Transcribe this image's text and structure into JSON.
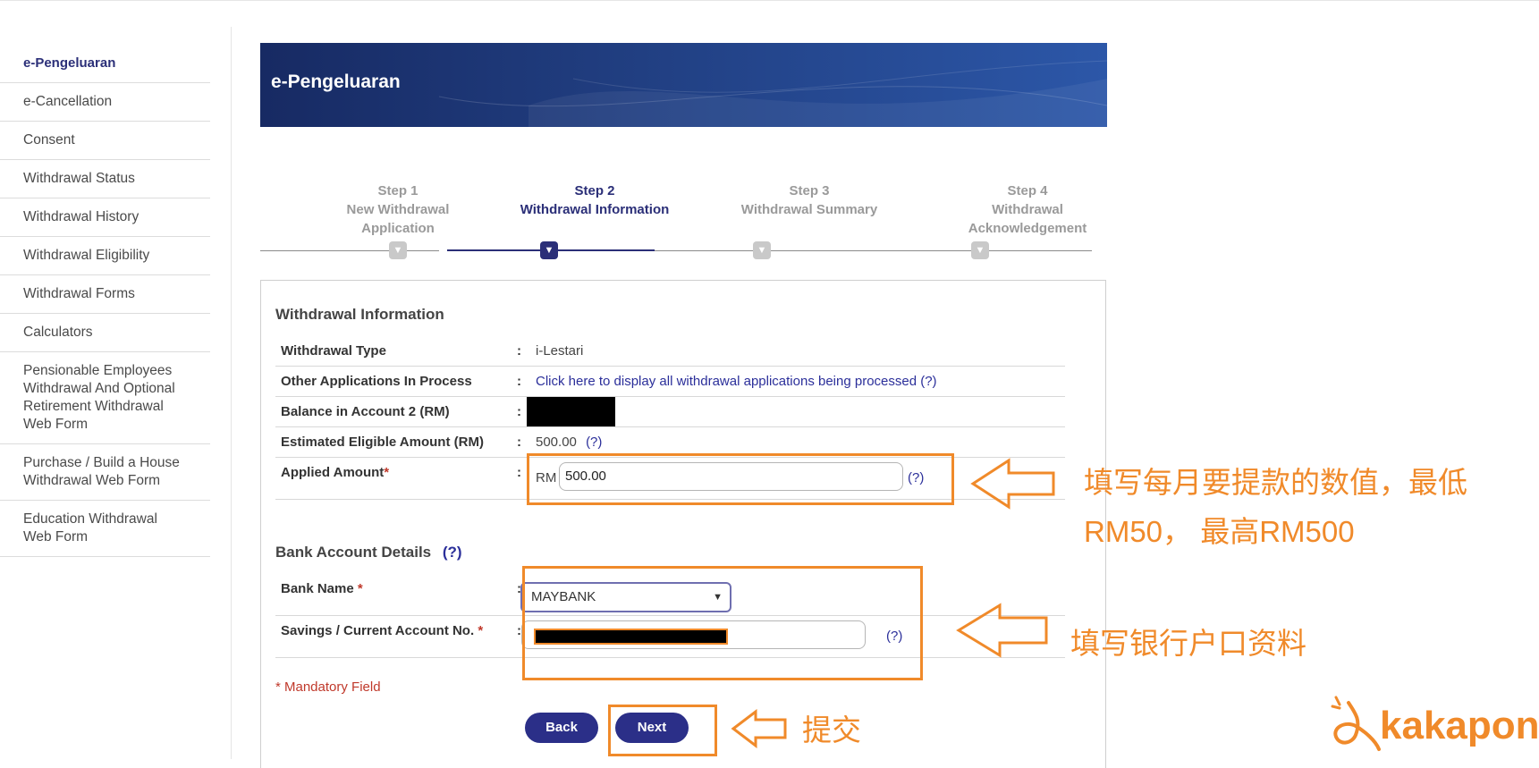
{
  "sidebar": {
    "items": [
      {
        "label": "e-Pengeluaran"
      },
      {
        "label": "e-Cancellation"
      },
      {
        "label": "Consent"
      },
      {
        "label": "Withdrawal Status"
      },
      {
        "label": "Withdrawal History"
      },
      {
        "label": "Withdrawal Eligibility"
      },
      {
        "label": "Withdrawal Forms"
      },
      {
        "label": "Calculators"
      },
      {
        "label": "Pensionable Employees Withdrawal And Optional Retirement Withdrawal Web Form"
      },
      {
        "label": "Purchase / Build a House Withdrawal Web Form"
      },
      {
        "label": "Education Withdrawal Web Form"
      }
    ]
  },
  "banner": {
    "title": "e-Pengeluaran"
  },
  "steps": [
    {
      "num": "Step 1",
      "name": "New Withdrawal Application"
    },
    {
      "num": "Step 2",
      "name": "Withdrawal Information"
    },
    {
      "num": "Step 3",
      "name": "Withdrawal Summary"
    },
    {
      "num": "Step 4",
      "name": "Withdrawal Acknowledgement"
    }
  ],
  "withdrawal_info": {
    "title": "Withdrawal Information",
    "rows": {
      "type": {
        "label": "Withdrawal Type",
        "value": "i-Lestari"
      },
      "other": {
        "label": "Other Applications In Process",
        "link": "Click here to display all withdrawal applications being processed (?)"
      },
      "balance": {
        "label": "Balance in Account 2 (RM)"
      },
      "estimated": {
        "label": "Estimated Eligible Amount (RM)",
        "value": "500.00",
        "help": "(?)"
      },
      "applied": {
        "label": "Applied Amount",
        "required": "*",
        "currency": "RM",
        "value": "500.00",
        "help": "(?)"
      }
    },
    "colon": ":"
  },
  "bank": {
    "title": "Bank Account Details",
    "help": "(?)",
    "bank_name": {
      "label": "Bank Name",
      "required": "*",
      "value": "MAYBANK"
    },
    "account_no": {
      "label": "Savings / Current Account No.",
      "required": "*",
      "help": "(?)"
    }
  },
  "mandatory_note": "* Mandatory Field",
  "buttons": {
    "back": "Back",
    "next": "Next"
  },
  "annotations": {
    "amount_line1": "填写每月要提款的数值，最低",
    "amount_line2": "RM50， 最高RM500",
    "bank": "填写银行户口资料",
    "submit": "提交",
    "color": "#f08a2a"
  },
  "logo": {
    "text": "kakapon"
  }
}
